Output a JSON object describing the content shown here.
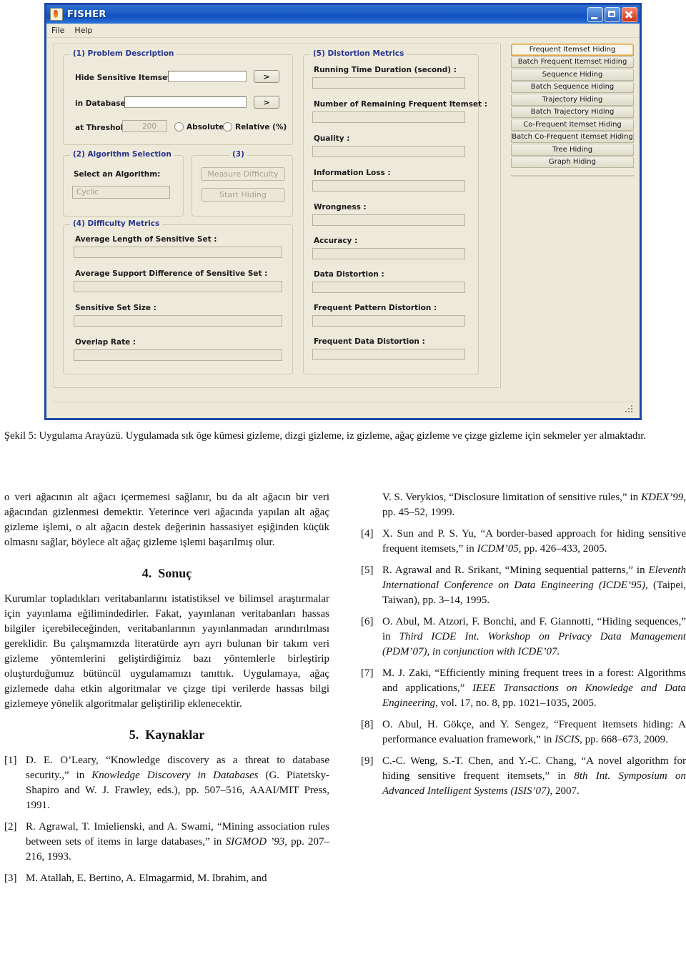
{
  "app": {
    "window_title": "FISHER",
    "icon": "flame-icon",
    "window_buttons": {
      "minimize": "minimize-icon",
      "maximize": "maximize-icon",
      "close": "close-icon"
    },
    "menu": [
      {
        "label": "File"
      },
      {
        "label": "Help"
      }
    ],
    "problem_description": {
      "legend": "(1) Problem Description",
      "itemset_label": "Hide Sensitive Itemset Set",
      "itemset_value": "",
      "itemset_browse_label": ">",
      "database_label": "in Database",
      "database_value": "",
      "database_browse_label": ">",
      "threshold_label": "at Threshold",
      "threshold_value": "200",
      "radio_absolute": "Absolute",
      "radio_relative": "Relative (%)"
    },
    "algorithm_selection": {
      "legend": "(2) Algorithm Selection",
      "select_label": "Select an Algorithm:",
      "selected_algorithm": "Cyclic"
    },
    "actions": {
      "legend": "(3)",
      "measure_difficulty": "Measure Difficulty",
      "start_hiding": "Start Hiding"
    },
    "difficulty_metrics": {
      "legend": "(4) Difficulty Metrics",
      "fields": [
        {
          "label": "Average Length of Sensitive Set :",
          "value": ""
        },
        {
          "label": "Average Support Difference of Sensitive Set :",
          "value": ""
        },
        {
          "label": "Sensitive Set Size :",
          "value": ""
        },
        {
          "label": "Overlap Rate :",
          "value": ""
        }
      ]
    },
    "distortion_metrics": {
      "legend": "(5) Distortion Metrics",
      "fields": [
        {
          "label": "Running Time Duration (second) :",
          "value": ""
        },
        {
          "label": "Number of Remaining Frequent Itemset :",
          "value": ""
        },
        {
          "label": "Quality :",
          "value": ""
        },
        {
          "label": "Information Loss :",
          "value": ""
        },
        {
          "label": "Wrongness :",
          "value": ""
        },
        {
          "label": "Accuracy :",
          "value": ""
        },
        {
          "label": "Data Distortion :",
          "value": ""
        },
        {
          "label": "Frequent Pattern Distortion :",
          "value": ""
        },
        {
          "label": "Frequent Data Distortion :",
          "value": ""
        }
      ]
    },
    "tabs": [
      {
        "label": "Frequent Itemset Hiding",
        "active": true
      },
      {
        "label": "Batch Frequent Itemset Hiding",
        "active": false
      },
      {
        "label": "Sequence Hiding",
        "active": false
      },
      {
        "label": "Batch Sequence Hiding",
        "active": false
      },
      {
        "label": "Trajectory Hiding",
        "active": false
      },
      {
        "label": "Batch Trajectory Hiding",
        "active": false
      },
      {
        "label": "Co-Frequent Itemset Hiding",
        "active": false
      },
      {
        "label": "Batch Co-Frequent Itemset Hiding",
        "active": false
      },
      {
        "label": "Tree Hiding",
        "active": false
      },
      {
        "label": "Graph Hiding",
        "active": false
      }
    ],
    "colors": {
      "title_bar": "#1d5fc8",
      "legend_text": "#29348f",
      "panel_bg": "#ece9d8",
      "active_tab_border": "#d8a33c"
    }
  },
  "figure_caption": "Şekil 5: Uygulama Arayüzü. Uygulamada sık öge kümesi gizleme, dizgi gizleme, iz gizleme, ağaç gizleme ve çizge gizleme için sekmeler yer almaktadır.",
  "left_column": {
    "paragraph_continued": "o veri ağacının alt ağacı içermemesi sağlanır, bu da alt ağacın bir veri ağacından gizlenmesi demektir. Yeterince veri ağacında yapılan alt ağaç gizleme işlemi, o alt ağacın destek değerinin hassasiyet eşiğinden küçük olmasnı sağlar, böylece alt ağaç gizleme işlemi başarılmış olur.",
    "section_conclusion": {
      "number": "4.",
      "title": "Sonuç"
    },
    "conclusion_paragraph": "Kurumlar topladıkları veritabanlarını istatistiksel ve bilimsel araştırmalar için yayınlama eğilimindedirler. Fakat, yayınlanan veritabanları hassas bilgiler içerebileceğinden, veritabanlarının yayınlanmadan arındırılması gereklidir. Bu çalışmamızda literatürde ayrı ayrı bulunan bir takım veri gizleme yöntemlerini geliştirdiğimiz bazı yöntemlerle birleştirip oluşturduğumuz bütüncül uygulamamızı tanıttık. Uygulamaya, ağaç gizlemede daha etkin algoritmalar ve çizge tipi verilerde hassas bilgi gizlemeye yönelik algoritmalar geliştirilip eklenecektir.",
    "section_references": {
      "number": "5.",
      "title": "Kaynaklar"
    },
    "references": [
      {
        "tag": "[1]",
        "parts": [
          {
            "text": "D. E. O’Leary, “Knowledge discovery as a threat to database security.,” in ",
            "italic": false
          },
          {
            "text": "Knowledge Discovery in Databases",
            "italic": true
          },
          {
            "text": " (G. Piatetsky-Shapiro and W. J. Frawley, eds.), pp. 507–516, AAAI/MIT Press, 1991.",
            "italic": false
          }
        ]
      },
      {
        "tag": "[2]",
        "parts": [
          {
            "text": "R. Agrawal, T. Imielienski, and A. Swami, “Mining association rules between sets of items in large databases,” in ",
            "italic": false
          },
          {
            "text": "SIGMOD ’93",
            "italic": true
          },
          {
            "text": ", pp. 207–216, 1993.",
            "italic": false
          }
        ]
      },
      {
        "tag": "[3]",
        "parts": [
          {
            "text": "M. Atallah, E. Bertino, A. Elmagarmid, M. Ibrahim, and",
            "italic": false
          }
        ]
      }
    ]
  },
  "right_column": {
    "references": [
      {
        "tag": "",
        "continuation": true,
        "parts": [
          {
            "text": "V. S. Verykios, “Disclosure limitation of sensitive rules,” in ",
            "italic": false
          },
          {
            "text": "KDEX’99",
            "italic": true
          },
          {
            "text": ", pp. 45–52, 1999.",
            "italic": false
          }
        ]
      },
      {
        "tag": "[4]",
        "parts": [
          {
            "text": "X. Sun and P. S. Yu, “A border-based approach for hiding sensitive frequent itemsets,” in ",
            "italic": false
          },
          {
            "text": "ICDM’05",
            "italic": true
          },
          {
            "text": ", pp. 426–433, 2005.",
            "italic": false
          }
        ]
      },
      {
        "tag": "[5]",
        "parts": [
          {
            "text": "R. Agrawal and R. Srikant, “Mining sequential patterns,” in ",
            "italic": false
          },
          {
            "text": "Eleventh International Conference on Data Engineering (ICDE’95)",
            "italic": true
          },
          {
            "text": ", (Taipei, Taiwan), pp. 3–14, 1995.",
            "italic": false
          }
        ]
      },
      {
        "tag": "[6]",
        "parts": [
          {
            "text": "O. Abul, M. Atzori, F. Bonchi, and F. Giannotti, “Hiding sequences,” in ",
            "italic": false
          },
          {
            "text": "Third ICDE Int. Workshop on Privacy Data Management (PDM’07), in conjunction with ICDE’07.",
            "italic": true
          }
        ]
      },
      {
        "tag": "[7]",
        "parts": [
          {
            "text": "M. J. Zaki, “Efficiently mining frequent trees in a forest: Algorithms and applications,” ",
            "italic": false
          },
          {
            "text": "IEEE Transactions on Knowledge and Data Engineering",
            "italic": true
          },
          {
            "text": ", vol. 17, no. 8, pp. 1021–1035, 2005.",
            "italic": false
          }
        ]
      },
      {
        "tag": "[8]",
        "parts": [
          {
            "text": "O. Abul, H. Gökçe, and Y. Sengez, “Frequent itemsets hiding: A performance evaluation framework,” in ",
            "italic": false
          },
          {
            "text": "ISCIS",
            "italic": true
          },
          {
            "text": ", pp. 668–673, 2009.",
            "italic": false
          }
        ]
      },
      {
        "tag": "[9]",
        "parts": [
          {
            "text": "C.-C. Weng, S.-T. Chen, and Y.-C. Chang, “A novel algorithm for hiding sensitive frequent itemsets,” in ",
            "italic": false
          },
          {
            "text": "8th Int. Symposium on Advanced Intelligent Systems (ISIS’07)",
            "italic": true
          },
          {
            "text": ", 2007.",
            "italic": false
          }
        ]
      }
    ]
  }
}
